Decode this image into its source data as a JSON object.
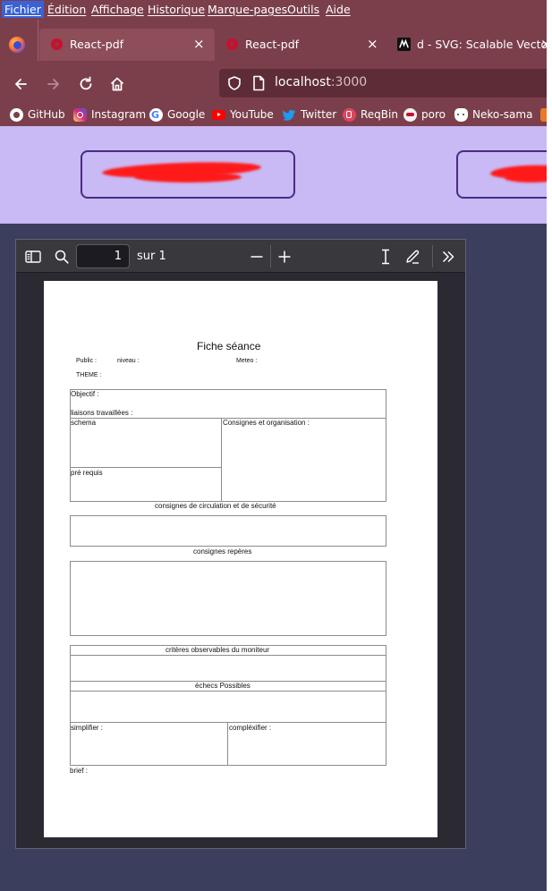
{
  "menu": [
    "Fichier",
    "Édition",
    "Affichage",
    "Historique",
    "Marque-pages",
    "Outils",
    "Aide"
  ],
  "tabs": [
    {
      "label": "React-pdf",
      "close": "×"
    },
    {
      "label": "React-pdf",
      "close": "×"
    },
    {
      "label": "d - SVG: Scalable Vector G",
      "close": "×"
    }
  ],
  "url": {
    "host": "localhost",
    "port": ":3000"
  },
  "bookmarks": [
    "GitHub",
    "Instagram",
    "Google",
    "YouTube",
    "Twitter",
    "ReqBin",
    "poro",
    "Neko-sama"
  ],
  "pdf_viewer": {
    "page_number": "1",
    "page_count": "sur 1"
  },
  "document": {
    "title": "Fiche séance",
    "public_label": "Public :",
    "niveau_label": "niveau :",
    "meteo_label": "Meteo :",
    "theme_label": "THEME :",
    "objectif_label": "Objectif :",
    "liaisons_label": "liaisons travaillées :",
    "schema_label": "schema",
    "consignes_org_label": "Consignes et organisation :",
    "prerequis_label": "pré requis",
    "circulation_heading": "consignes de circulation et de sécurité",
    "reperes_heading": "consignes repères",
    "criteres_heading": "critères observables du moniteur",
    "echecs_heading": "échecs Possibles",
    "simplifier_label": "simplifier :",
    "complexifier_label": "compléxifier :",
    "brief_label": "brief :"
  },
  "colors": {
    "browser_chrome": "#7b3f4c",
    "page_header": "#c9b9f4",
    "page_body": "#3c3e5e",
    "redaction": "#ff1a1a",
    "viewer_bg": "#2b2a33"
  }
}
